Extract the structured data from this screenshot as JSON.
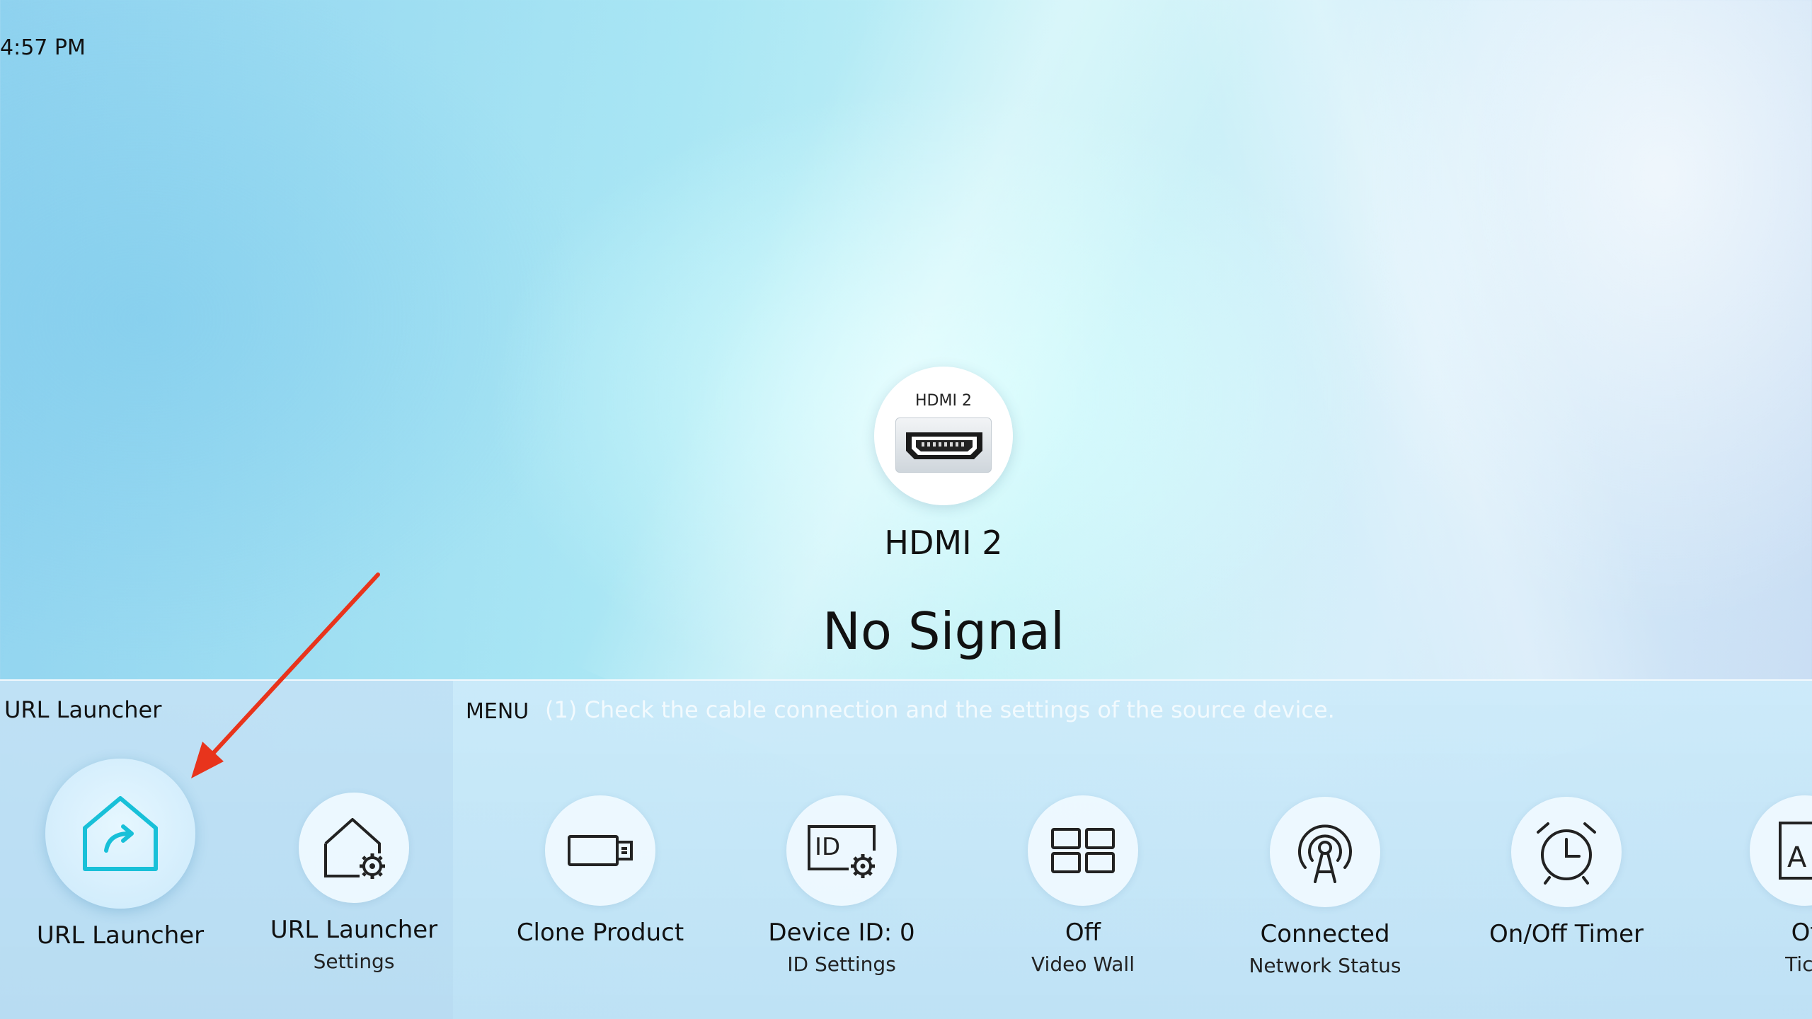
{
  "status_bar": {
    "time": "4:57 PM"
  },
  "source": {
    "badge_label": "HDMI 2",
    "name": "HDMI 2",
    "message": "No Signal"
  },
  "panel": {
    "title": "URL Launcher",
    "menu_label": "MENU",
    "hint": "(1) Check the cable connection and the settings of the source device.",
    "items": [
      {
        "label": "URL Launcher",
        "sub": "",
        "icon": "home-arrow-icon",
        "selected": true
      },
      {
        "label": "URL Launcher",
        "sub": "Settings",
        "icon": "home-gear-icon"
      },
      {
        "label": "Clone Product",
        "sub": "",
        "icon": "usb-stick-icon"
      },
      {
        "label": "Device ID: 0",
        "sub": "ID Settings",
        "icon": "id-gear-icon"
      },
      {
        "label": "Off",
        "sub": "Video Wall",
        "icon": "video-wall-icon"
      },
      {
        "label": "Connected",
        "sub": "Network Status",
        "icon": "network-antenna-icon"
      },
      {
        "label": "On/Off Timer",
        "sub": "",
        "icon": "alarm-clock-icon"
      },
      {
        "label": "Of",
        "sub": "Tick",
        "icon": "text-box-icon"
      }
    ]
  },
  "colors": {
    "accent": "#18c0d8",
    "annotation_arrow": "#e8341c"
  }
}
